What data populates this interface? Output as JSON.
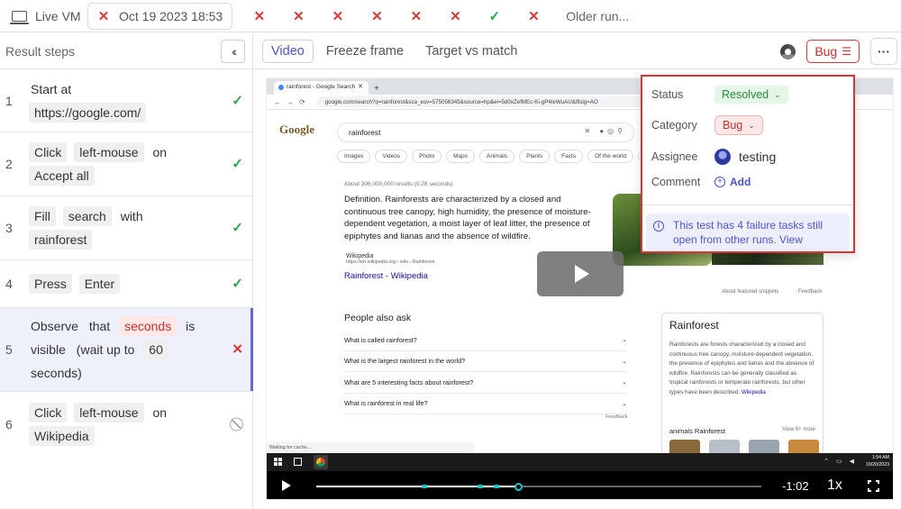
{
  "topbar": {
    "live_vm_label": "Live VM",
    "current_run_label": "Oct 19 2023 18:53",
    "run_statuses": [
      "fail",
      "fail",
      "fail",
      "fail",
      "fail",
      "fail",
      "pass",
      "fail"
    ],
    "older_runs_label": "Older run..."
  },
  "sidebar": {
    "title": "Result steps",
    "steps": [
      {
        "number": "1",
        "text": "Start at",
        "url": "https://google.com/",
        "status": "pass"
      },
      {
        "number": "2",
        "action": "Click",
        "target": "left-mouse",
        "on": "on",
        "object": "Accept all",
        "status": "pass"
      },
      {
        "number": "3",
        "action": "Fill",
        "target": "search",
        "with": "with",
        "value": "rainforest",
        "status": "pass"
      },
      {
        "number": "4",
        "action": "Press",
        "key": "Enter",
        "status": "pass"
      },
      {
        "number": "5",
        "action": "Observe",
        "that": "that",
        "subject": "seconds",
        "is": "is",
        "visible": "visible",
        "wait": "(wait up to",
        "wait_value": "60",
        "unit": "seconds)",
        "status": "fail"
      },
      {
        "number": "6",
        "action": "Click",
        "target": "left-mouse",
        "on": "on",
        "object": "Wikipedia",
        "status": "skipped"
      }
    ]
  },
  "view": {
    "tabs": [
      "Video",
      "Freeze frame",
      "Target vs match"
    ],
    "active_tab": "Video",
    "bug_label": "Bug"
  },
  "popup": {
    "status_label": "Status",
    "status_value": "Resolved",
    "category_label": "Category",
    "category_value": "Bug",
    "assignee_label": "Assignee",
    "assignee_value": "testing",
    "comment_label": "Comment",
    "add_label": "Add",
    "info_text": "This test has 4 failure tasks still open from other runs. View"
  },
  "browser": {
    "tab_title": "rainforest - Google Search",
    "url": "google.com/search?q=rainforest&sca_esv=575056345&source=hp&ei=5d0xZefMEc-Ki-gP4teWuAU&iflsig=AO",
    "search_query": "rainforest",
    "chips": [
      "Images",
      "Videos",
      "Photo",
      "Maps",
      "Animals",
      "Plants",
      "Facts",
      "Of the world",
      "News"
    ],
    "results_count": "About 306,000,000 results (0.28 seconds)",
    "definition": "Definition. Rainforests are characterized by a closed and continuous tree canopy, high humidity, the presence of moisture-dependent vegetation, a moist layer of leaf litter, the presence of epiphytes and lianas and the absence of wildfire.",
    "wiki_source": "Wikipedia",
    "wiki_url": "https://en.wikipedia.org › wiki › Rainforest",
    "wiki_link": "Rainforest - Wikipedia",
    "about_snippets": "About featured snippets",
    "feedback": "Feedback",
    "paa_title": "People also ask",
    "paa": [
      "What is called rainforest?",
      "What is the largest rainforest in the world?",
      "What are 5 interesting facts about rainforest?",
      "What is rainforest in real life?"
    ],
    "kp_title": "Rainforest",
    "kp_text": "Rainforests are forests characterized by a closed and continuous tree canopy, moisture-dependent vegetation, the presence of epiphytes and lianas and the absence of wildfire. Rainforests can be generally classified as tropical rainforests or temperate rainforests, but other types have been described.",
    "kp_more": "Wikipedia",
    "kp_sub": "animals Rainforest",
    "kp_subright": "View 5+ more",
    "status_text": "Waiting for cache...",
    "clock_time": "1:54 AM",
    "clock_date": "10/20/2023"
  },
  "player": {
    "time_remaining": "-1:02",
    "speed": "1x",
    "progress": 0.455,
    "markers": [
      0.242,
      0.369,
      0.405,
      0.455
    ]
  }
}
